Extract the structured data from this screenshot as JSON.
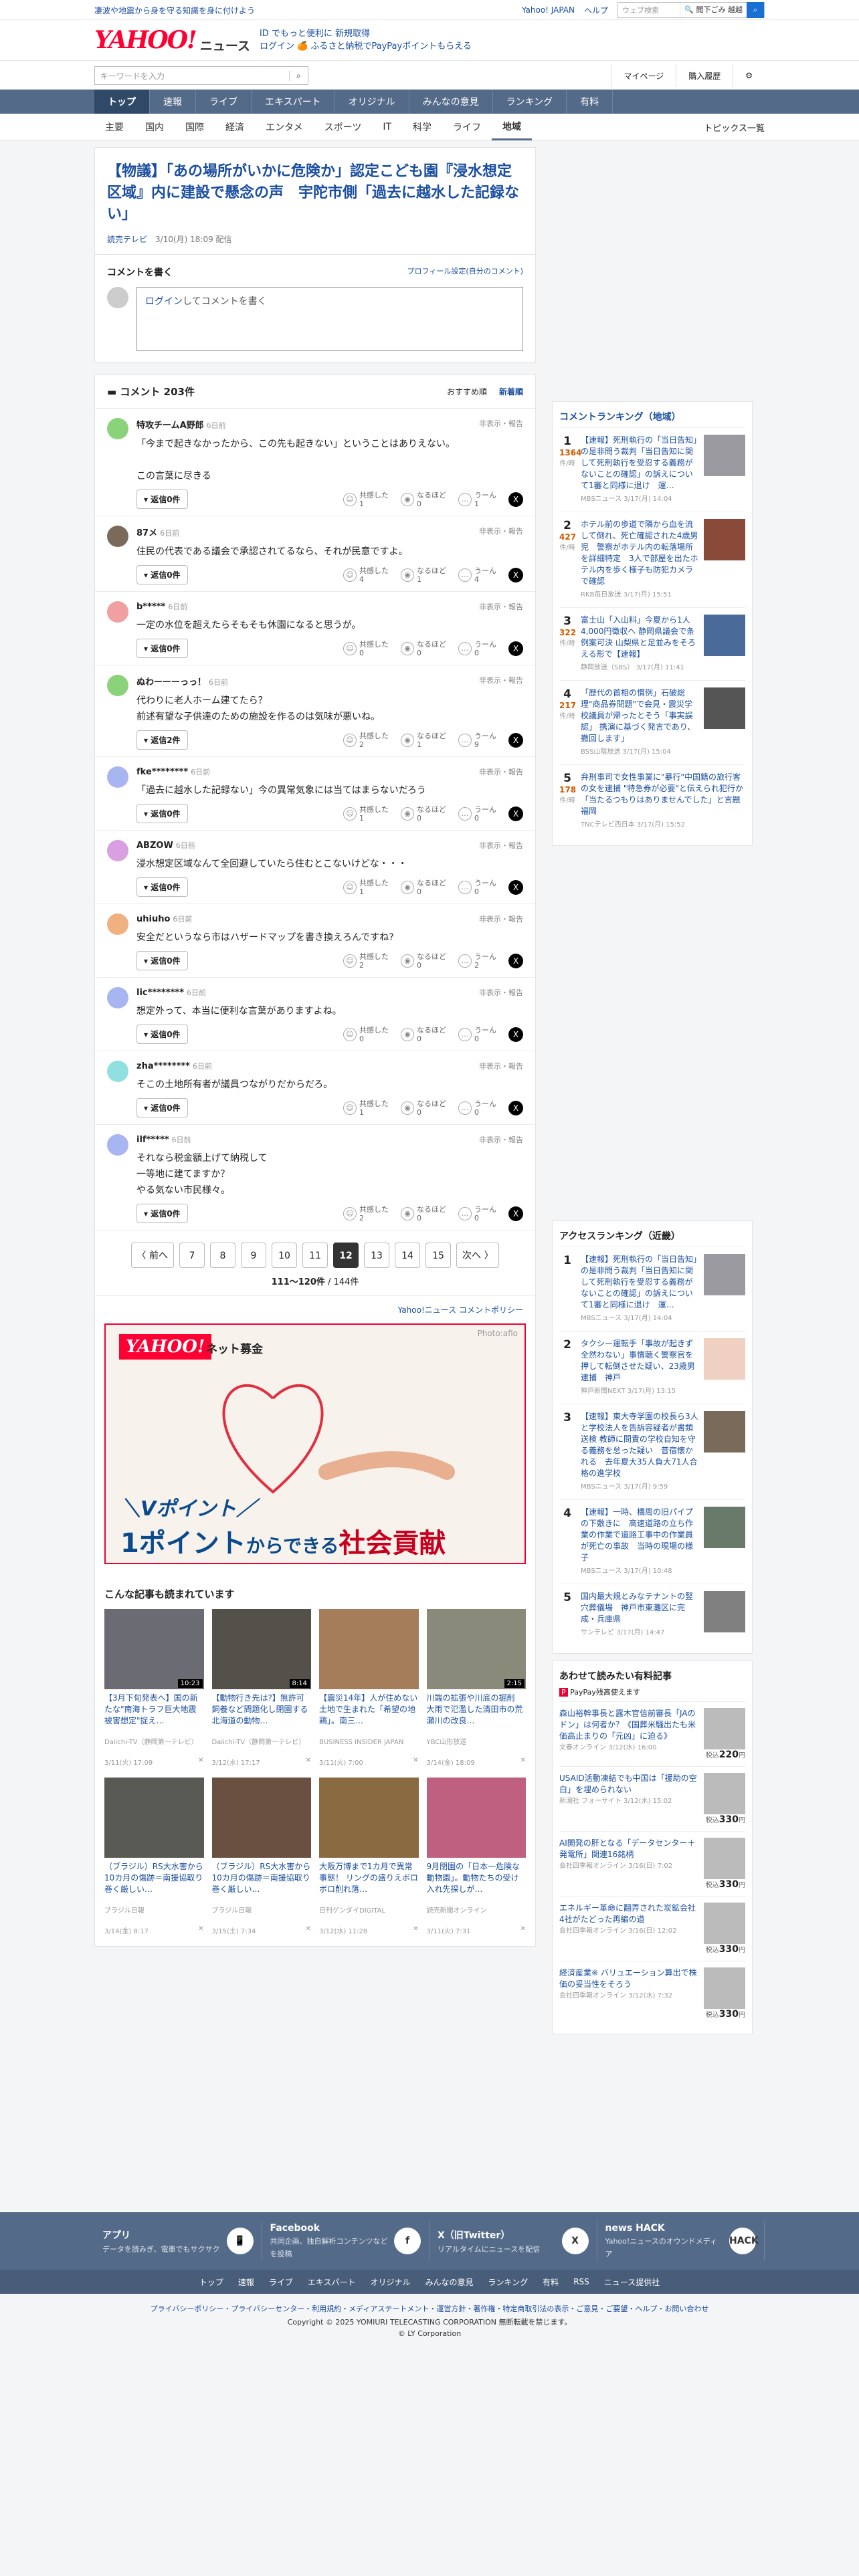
{
  "top": {
    "note": "凄波や地震から身を守る知識を身に付けよう",
    "links": [
      "Yahoo! JAPAN",
      "ヘルプ"
    ],
    "search_placeholder": "ウェブ検索",
    "search_btn": "🔍 閲下ごみ 越越"
  },
  "brand": {
    "logo": "YAHOO!",
    "logo_sub": "JAPAN",
    "service": "ニュース",
    "promo1": "ID でもっと便利に 新規取得",
    "promo2": "ログイン 🍊 ふるさと納税でPayPayポイントもらえる"
  },
  "searchrow": {
    "placeholder": "キーワードを入力",
    "mypage": "マイページ",
    "history": "購入履歴"
  },
  "gnav": [
    "トップ",
    "速報",
    "ライブ",
    "エキスパート",
    "オリジナル",
    "みんなの意見",
    "ランキング",
    "有料"
  ],
  "subnav": {
    "items": [
      "主要",
      "国内",
      "国際",
      "経済",
      "エンタメ",
      "スポーツ",
      "IT",
      "科学",
      "ライフ",
      "地域"
    ],
    "topics": "トピックス一覧"
  },
  "article": {
    "title": "【物議】「あの場所がいかに危険か」認定こども園『浸水想定区域』内に建設で懸念の声　宇陀市側「過去に越水した記録ない」",
    "source": "読売テレビ",
    "date": "3/10(月) 18:09 配信"
  },
  "comment_write": {
    "title": "コメントを書く",
    "profile": "プロフィール設定(自分のコメント)",
    "login": "ログイン",
    "placeholder": "してコメントを書く"
  },
  "comments_header": {
    "title": "コメント 203件",
    "sort_recommend": "おすすめ順",
    "sort_new": "新着順"
  },
  "reply_label_fmt": "返信",
  "flags": "非表示・報告",
  "reaction_labels": [
    "共感した",
    "なるほど",
    "うーん"
  ],
  "comments": [
    {
      "name": "特攻チームA野郎",
      "ago": "6日前",
      "text": "「今まで起きなかったから、この先も起きない」ということはありえない。\n\nこの言葉に尽きる",
      "reply": "返信0件",
      "r": [
        "1",
        "0",
        "1"
      ],
      "color": "#8bd37a"
    },
    {
      "name": "87メ",
      "ago": "6日前",
      "text": "住民の代表である議会で承認されてるなら、それが民意ですよ。",
      "reply": "返信0件",
      "r": [
        "4",
        "1",
        "4"
      ],
      "color": "#7a6a5a"
    },
    {
      "name": "b*****",
      "ago": "6日前",
      "text": "一定の水位を超えたらそもそも休園になると思うが。",
      "reply": "返信0件",
      "r": [
        "0",
        "0",
        "0"
      ],
      "color": "#f0a0a0"
    },
    {
      "name": "ぬわーーーっっ！",
      "ago": "6日前",
      "text": "代わりに老人ホーム建てたら？\n前述有望な子供達のための施設を作るのは気味が悪いね。",
      "reply": "返信2件",
      "r": [
        "2",
        "1",
        "9"
      ],
      "color": "#8bd37a"
    },
    {
      "name": "fke********",
      "ago": "6日前",
      "text": "「過去に越水した記録ない」今の異常気象には当てはまらないだろう",
      "reply": "返信0件",
      "r": [
        "1",
        "0",
        "0"
      ],
      "color": "#a9b5f0"
    },
    {
      "name": "ABZOW",
      "ago": "6日前",
      "text": "浸水想定区域なんて全回避していたら住むとこないけどな・・・",
      "reply": "返信0件",
      "r": [
        "1",
        "0",
        "0"
      ],
      "color": "#d8a0e0"
    },
    {
      "name": "uhiuho",
      "ago": "6日前",
      "text": "安全だというなら市はハザードマップを書き換えろんですね?",
      "reply": "返信0件",
      "r": [
        "2",
        "0",
        "2"
      ],
      "color": "#f0b080"
    },
    {
      "name": "lic********",
      "ago": "6日前",
      "text": "想定外って、本当に便利な言葉がありますよね。",
      "reply": "返信0件",
      "r": [
        "0",
        "0",
        "0"
      ],
      "color": "#a9b5f0"
    },
    {
      "name": "zha********",
      "ago": "6日前",
      "text": "そこの土地所有者が議員つながりだからだろ。",
      "reply": "返信0件",
      "r": [
        "1",
        "0",
        "0"
      ],
      "color": "#90e0e0"
    },
    {
      "name": "ilf*****",
      "ago": "6日前",
      "text": "それなら税金額上げて納税して\n一等地に建てますか？\nやる気ない市民様々。",
      "reply": "返信0件",
      "r": [
        "2",
        "0",
        "0"
      ],
      "color": "#a9b5f0"
    }
  ],
  "pager": {
    "prev": "〈 前へ",
    "pages": [
      "7",
      "8",
      "9",
      "10",
      "11",
      "12",
      "13",
      "14",
      "15"
    ],
    "current": "12",
    "next": "次へ 〉",
    "count": "111〜120件",
    "total": "/ 144件"
  },
  "policy": "Yahoo!ニュース コメントポリシー",
  "ad": {
    "logo": "YAHOO!",
    "sub": "ネット募金",
    "photo": "Photo:afio",
    "line1": "＼Vポイント／",
    "line2a": "1ポイント",
    "line2b": "からできる",
    "line2c": "社会貢献"
  },
  "reads": {
    "title": "こんな記事も読まれています",
    "items": [
      {
        "title": "【3月下旬発表へ】国の新たな\"南海トラフ巨大地震被害想定\"捉え…",
        "source": "Daiichi-TV（静岡第一テレビ）",
        "date": "3/11(火) 17:09",
        "dur": "10:23",
        "bg": "#6b6b73"
      },
      {
        "title": "【動物行き先は?】無許可飼養など問題化し閉園する北海道の動物…",
        "source": "Daiichi-TV（静岡第一テレビ）",
        "date": "3/12(水) 17:17",
        "dur": "8:14",
        "bg": "#54504a"
      },
      {
        "title": "【震災14年】人が住めない土地で生まれた「希望の地鶏」。南三…",
        "source": "BUSINESS INSIDER JAPAN",
        "date": "3/11(火) 7:00",
        "dur": "",
        "bg": "#a67d5a"
      },
      {
        "title": "川端の拡張や川底の掘削　大雨で氾濫した清田市の荒瀬川の改良…",
        "source": "YBC山形放送",
        "date": "3/14(金) 18:09",
        "dur": "2:15",
        "bg": "#8a8a7a"
      },
      {
        "title": "（ブラジル）RS大水害から10カ月の傷跡＝南援協取り巻く厳しい…",
        "source": "ブラジル日報",
        "date": "3/14(金) 8:17",
        "dur": "",
        "bg": "#5a5a55"
      },
      {
        "title": "（ブラジル）RS大水害から10カ月の傷跡＝南援協取り巻く厳しい…",
        "source": "ブラジル日報",
        "date": "3/15(土) 7:34",
        "dur": "",
        "bg": "#6a5040"
      },
      {
        "title": "大阪万博まで1カ月で異常事態！ リングの盛りえボロボロ削れ落…",
        "source": "日刊ゲンダイDIGITAL",
        "date": "3/12(水) 11:28",
        "dur": "",
        "bg": "#8a6a40"
      },
      {
        "title": "9月閉園の「日本一危険な動物園」。動物たちの受け入れ先探しが…",
        "source": "読売新聞オンライン",
        "date": "3/11(火) 7:31",
        "dur": "",
        "bg": "#c06080"
      }
    ]
  },
  "comment_ranking": {
    "title": "コメントランキング（地域）",
    "unit": "件/時",
    "items": [
      {
        "n": "1",
        "c": "1364",
        "text": "【速報】死刑執行の「当日告知」の是非問う裁判「当日告知に関して死刑執行を受忍する義務がないことの確認」の訴えについて1審と同様に退け　運…",
        "src": "MBSニュース 3/17(月) 14:04",
        "bg": "#9a9aa0"
      },
      {
        "n": "2",
        "c": "427",
        "text": "ホテル前の歩道で隣から血を流して倒れ、死亡確認された4歳男児　警察がホテル内の転落場所を詳細特定　3人で部屋を出たホテル内を歩く様子も防犯カメラで確認",
        "src": "RKB毎日放送 3/17(月) 15:51",
        "bg": "#8a4a3a"
      },
      {
        "n": "3",
        "c": "322",
        "text": "富士山「入山料」今夏から1人4,000円徴収へ 静岡県議会で条例案可決 山梨県と足並みをそろえる形で【速報】",
        "src": "静岡放送（SBS） 3/17(月) 11:41",
        "bg": "#4a6a9a"
      },
      {
        "n": "4",
        "c": "217",
        "text": "「歴代の首相の慣例」石破総理\"商品券問題\"で会見・震災学校議員が帰ったとそう「事実誤認」 携演に基づく発言であり、撤回します」",
        "src": "BSS山陰放送 3/17(月) 15:04",
        "bg": "#555"
      },
      {
        "n": "5",
        "c": "178",
        "text": "弁刑事司で女性事業に\"暴行\"中国籍の旅行客の女を逮捕 \"特急券が必要\"と伝えられ犯行か「当たるつもりはありませんでした」と言題　福岡",
        "src": "TNCテレビ西日本 3/17(月) 15:52",
        "bg": ""
      }
    ]
  },
  "access_ranking": {
    "title": "アクセスランキング（近畿）",
    "items": [
      {
        "n": "1",
        "text": "【速報】死刑執行の「当日告知」の是非問う裁判「当日告知に関して死刑執行を受忍する義務がないことの確認」の訴えについて1審と同様に退け　運…",
        "src": "MBSニュース 3/17(月) 14:04",
        "bg": "#9a9aa0"
      },
      {
        "n": "2",
        "text": "タクシー運転手「事故が起きず全然わない」事情聴く警察官を押して転倒させた疑い、23歳男逮捕　神戸",
        "src": "神戸新聞NEXT 3/17(月) 13:15",
        "bg": "#f0d0c0"
      },
      {
        "n": "3",
        "text": "【速報】東大寺学園の校長ら3人と学校法人を告訴容疑者が書類送検 教師に問責の学校自知を守る義務を怠った疑い　昔宿懐かれる　去年夏大35人負大71人合格の進学校",
        "src": "MBSニュース 3/17(月) 9:59",
        "bg": "#7a6a5a"
      },
      {
        "n": "4",
        "text": "【速報】一時、橋周の旧パイプの下敷きに　高速道路の立ち作業の作業で道路工事中の作業員が死亡の事故　当時の現場の様子",
        "src": "MBSニュース 3/17(月) 10:48",
        "bg": "#6a7a6a"
      },
      {
        "n": "5",
        "text": "国内最大規とみなテナントの竪穴葬儀場　神戸市東灘区に完成・兵庫県",
        "src": "サンテレビ 3/17(月) 14:47",
        "bg": "#808080"
      }
    ]
  },
  "paid": {
    "title": "あわせて読みたい有料記事",
    "sub": "PayPay残高使えます",
    "items": [
      {
        "text": "森山裕幹事長と露木官信前審長「JAのドン」は何者か？《国葬米騒出たも米価高止まりの「元凶」に迫る》",
        "src": "文春オンライン 3/12(水) 16:00",
        "price": "220",
        "unit": "税込"
      },
      {
        "text": "USAID活動凍結でも中国は「援助の空白」を埋められない",
        "src": "新潮社 フォーサイト 3/12(水) 15:02",
        "price": "330",
        "unit": "税込"
      },
      {
        "text": "AI開発の肝となる「データセンター＋発電所」関連16銘柄",
        "src": "会社四季報オンライン 3/16(日) 7:02",
        "price": "330",
        "unit": "税込"
      },
      {
        "text": "エネルギー革命に翻弄された炭鉱会社4社がたどった再編の道",
        "src": "会社四季報オンライン 3/16(日) 12:02",
        "price": "330",
        "unit": "税込"
      },
      {
        "text": "経済産業※ バリュエーション算出で株価の妥当性をそろう",
        "src": "会社四季報オンライン 3/12(水) 7:32",
        "price": "330",
        "unit": "税込"
      }
    ]
  },
  "footer": {
    "boxes": [
      {
        "t": "アプリ",
        "d": "データを読みぎ、電車でもサクサク",
        "ic": "📱"
      },
      {
        "t": "Facebook",
        "d": "共同企画、独自解析コンテンツなどを投稿",
        "ic": "f"
      },
      {
        "t": "X（旧Twitter）",
        "d": "リアルタイムにニュースを配信",
        "ic": "X"
      },
      {
        "t": "news HACK",
        "d": "Yahoo!ニュースのオウンドメディア",
        "ic": "HACK"
      }
    ],
    "nav": [
      "トップ",
      "速報",
      "ライブ",
      "エキスパート",
      "オリジナル",
      "みんなの意見",
      "ランキング",
      "有料",
      "RSS",
      "ニュース提供社"
    ],
    "links": "プライバシーポリシー・プライバシーセンター・利用規約・メディアステートメント・運営方針・著作権・特定商取引法の表示・ご意見・ご要望・ヘルプ・お問い合わせ",
    "copy1": "Copyright © 2025 YOMIURI TELECASTING CORPORATION 無断転載を禁じます。",
    "copy2": "© LY Corporation"
  }
}
